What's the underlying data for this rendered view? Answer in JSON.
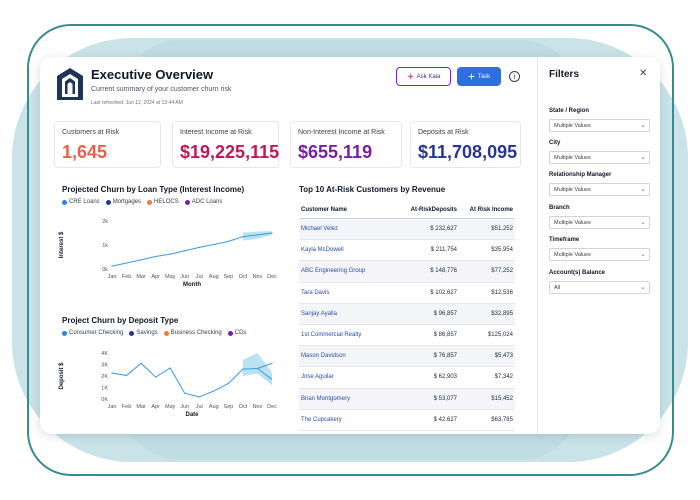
{
  "header": {
    "title": "Executive Overview",
    "subtitle": "Current summary of your customer churn risk",
    "refreshed": "Last refreshed: Jun 12, 2024 at 12:44 AM",
    "ask_label": "Ask Kaia",
    "task_label": "Task",
    "info_glyph": "i"
  },
  "kpis": [
    {
      "label": "Customers at Risk",
      "value": "1,645",
      "color": "#e8604c"
    },
    {
      "label": "Interest Income at Risk",
      "value": "$19,225,115",
      "color": "#c2185b"
    },
    {
      "label": "Non-Interest Income at Risk",
      "value": "$655,119",
      "color": "#7b1fa2"
    },
    {
      "label": "Deposits at Risk",
      "value": "$11,708,095",
      "color": "#283593"
    }
  ],
  "colors": {
    "accent": "#2f6fdd",
    "line": "#3b9ae1",
    "band": "#a8dcec"
  },
  "chart1": {
    "title": "Projected Churn by Loan Type (Interest Income)",
    "legend": [
      {
        "label": "CRE Loans",
        "color": "#2f80ed"
      },
      {
        "label": "Mortgages",
        "color": "#1e3a8a"
      },
      {
        "label": "HELOCS",
        "color": "#f07a3a"
      },
      {
        "label": "ADC Loans",
        "color": "#7b1fa2"
      }
    ]
  },
  "chart2": {
    "title": "Project Churn by Deposit Type",
    "legend": [
      {
        "label": "Consumer Checking",
        "color": "#2f80ed"
      },
      {
        "label": "Savings",
        "color": "#1e3a8a"
      },
      {
        "label": "Business Checking",
        "color": "#f07a3a"
      },
      {
        "label": "CDs",
        "color": "#7b1fa2"
      }
    ]
  },
  "chart_data": [
    {
      "type": "line",
      "title": "Projected Churn by Loan Type (Interest Income)",
      "xlabel": "Month",
      "ylabel": "Interest $",
      "categories": [
        "Jan",
        "Feb",
        "Mar",
        "Apr",
        "May",
        "Jun",
        "Jul",
        "Aug",
        "Sep",
        "Oct",
        "Nov",
        "Dec"
      ],
      "yticks": [
        "0k",
        "1k",
        "2k"
      ],
      "ylim": [
        0,
        2000
      ],
      "values": [
        120,
        250,
        380,
        520,
        620,
        760,
        900,
        1020,
        1150,
        1350,
        1420,
        1500
      ],
      "band": {
        "from_index": 9,
        "upper": [
          1520,
          1560,
          1580
        ],
        "lower": [
          1180,
          1260,
          1420
        ]
      }
    },
    {
      "type": "line",
      "title": "Project Churn by Deposit Type",
      "xlabel": "Date",
      "ylabel": "Deposit $",
      "categories": [
        "Jan",
        "Feb",
        "Mar",
        "Apr",
        "May",
        "Jun",
        "Jul",
        "Aug",
        "Sep",
        "Oct",
        "Nov",
        "Dec"
      ],
      "yticks": [
        "0K",
        "1K",
        "2K",
        "3K",
        "4K"
      ],
      "ylim": [
        0,
        4000
      ],
      "values": [
        2250,
        2050,
        3100,
        1900,
        2700,
        500,
        180,
        700,
        1350,
        2600,
        2650,
        3100
      ],
      "band": {
        "from_index": 9,
        "upper": [
          3400,
          4000,
          2300
        ],
        "lower": [
          2000,
          2200,
          1200
        ],
        "end_value": 1700
      }
    }
  ],
  "table": {
    "title": "Top 10 At-Risk Customers by Revenue",
    "headers": [
      "Customer Name",
      "At-RiskDeposits",
      "At Risk Income"
    ],
    "rows": [
      [
        "Michael Velez",
        "$ 232,627",
        "$51,252"
      ],
      [
        "Kayla McDowell",
        "$ 211,754",
        "$35,954"
      ],
      [
        "ABC Engineering Group",
        "$ 148,776",
        "$77,252"
      ],
      [
        "Tara Davis",
        "$ 102,627",
        "$12,536"
      ],
      [
        "Sanjay Ayalla",
        "$ 96,857",
        "$32,895"
      ],
      [
        "1st Commercial Realty",
        "$ 86,857",
        "$125,024"
      ],
      [
        "Mason Davidson",
        "$ 76,857",
        "$5,473"
      ],
      [
        "Jose Aguilar",
        "$ 62,903",
        "$7,342"
      ],
      [
        "Brian Montgomery",
        "$ 53,077",
        "$15,452"
      ],
      [
        "The Cupcakery",
        "$ 42,627",
        "$63,785"
      ]
    ]
  },
  "filters": {
    "title": "Filters",
    "close_glyph": "✕",
    "items": [
      {
        "label": "State / Region",
        "value": "Multiple Values"
      },
      {
        "label": "City",
        "value": "Multiple Values"
      },
      {
        "label": "Relationship Manager",
        "value": "Multiple Values"
      },
      {
        "label": "Branch",
        "value": "Multiple Values"
      },
      {
        "label": "Timeframe",
        "value": "Multiple Values"
      },
      {
        "label": "Account(s) Balance",
        "value": "All"
      }
    ]
  }
}
